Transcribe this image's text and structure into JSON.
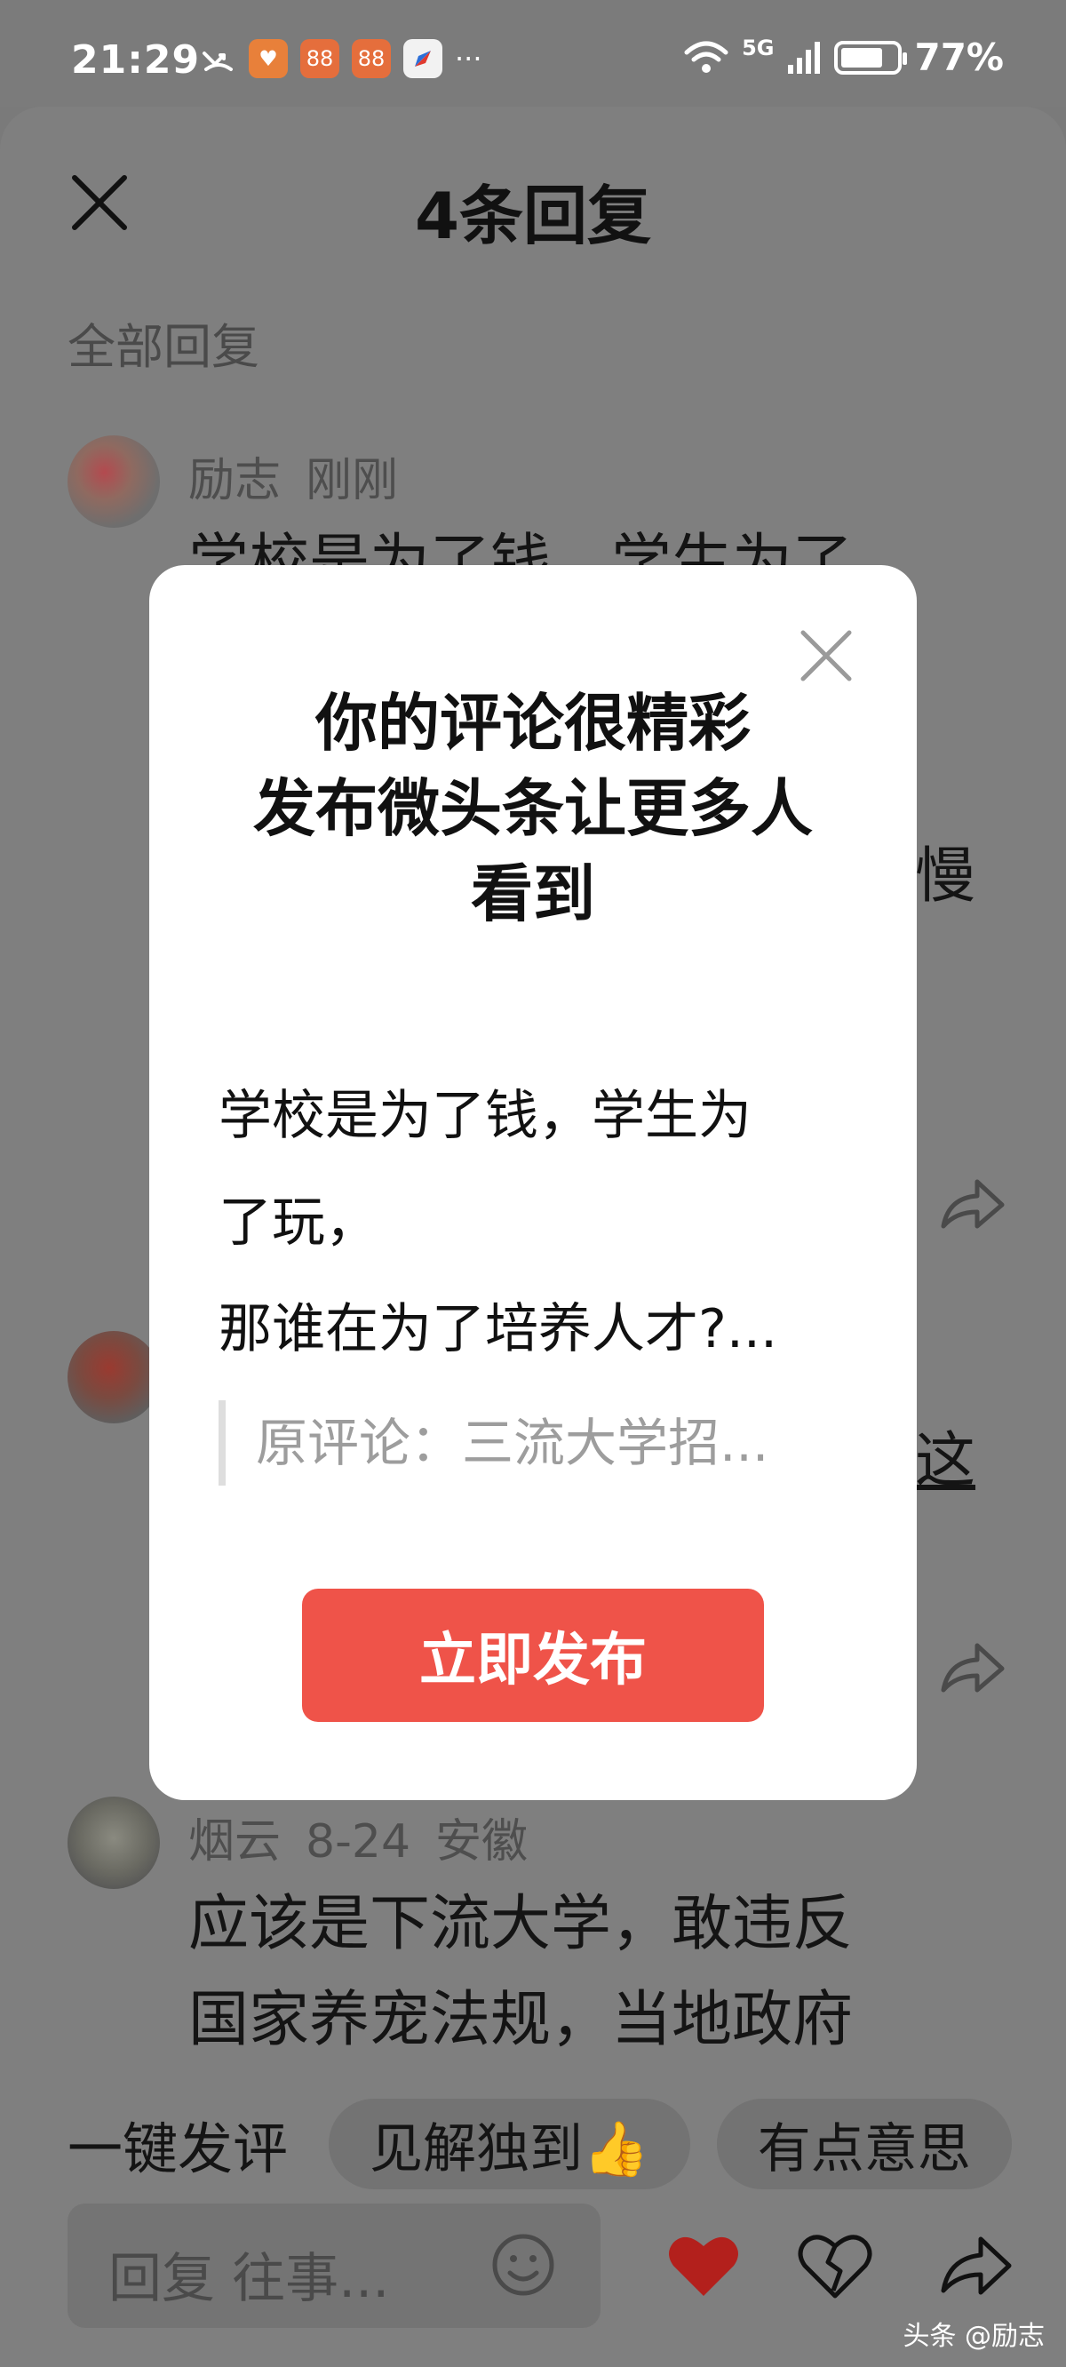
{
  "status_bar": {
    "time": "21:29",
    "network": "5G",
    "battery": "77%",
    "battery_level": 0.77,
    "more": "···"
  },
  "sheet": {
    "title": "4条回复",
    "section_label": "全部回复"
  },
  "comments": [
    {
      "author": "励志",
      "time": "刚刚",
      "location": "",
      "text_lines": [
        "学校是为了钱，学生为了"
      ]
    },
    {
      "author": "烟云",
      "time": "8-24",
      "location": "安徽",
      "text_lines": [
        "应该是下流大学，敢违反",
        "国家养宠法规，当地政府"
      ]
    }
  ],
  "peek_text": {
    "line_a": "慢",
    "line_b": "这"
  },
  "quick_replies": {
    "label": "一键发评",
    "chips": [
      "见解独到👍",
      "有点意思"
    ]
  },
  "input": {
    "placeholder": "回复 往事..."
  },
  "modal": {
    "title_lines": [
      "你的评论很精彩",
      "发布微头条让更多人",
      "看到"
    ],
    "body_lines": [
      "学校是为了钱，学生为",
      "了玩，",
      "那谁在为了培养人才?..."
    ],
    "quote": "原评论：三流大学招...",
    "button_label": "立即发布"
  },
  "watermark": "头条 @励志",
  "colors": {
    "accent_red": "#ef5349",
    "heart_red": "#b3201c",
    "overlay_gray": "#7f7f7f"
  }
}
